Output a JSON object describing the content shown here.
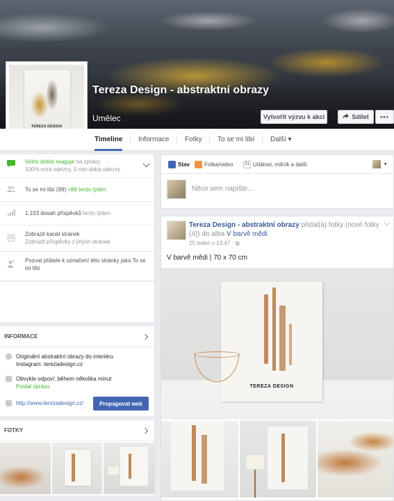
{
  "header": {
    "page_name": "Tereza Design - abstraktní obrazy",
    "category": "Umělec",
    "avatar_caption": "TEREZA DESIGN",
    "cta_label": "Vytvořit výzvu k akci",
    "share_label": "Sdílet",
    "more_label": "•••"
  },
  "tabs": [
    {
      "label": "Timeline",
      "active": true
    },
    {
      "label": "Informace"
    },
    {
      "label": "Fotky"
    },
    {
      "label": "To se mi líbí"
    },
    {
      "label": "Další ▾"
    }
  ],
  "left": {
    "responsiveness": {
      "title": "Velmi dobře reaguje",
      "title_suffix": " na zprávy",
      "detail": "100% míra odezvy, 5 min doba odezvy"
    },
    "likes": {
      "text": "To se mi líbí (99)",
      "growth": "+88 tento týden"
    },
    "reach": {
      "text": "1.103 dosah příspěvků",
      "suffix": " tento týden"
    },
    "channel": {
      "title": "Zobrazit kanál stránek",
      "subtitle": "Zobrazit příspěvky z jiných stránek"
    },
    "invite": {
      "text": "Pozvat přátele k označení této stránky jako To se mi líbí"
    },
    "info_header": "INFORMACE",
    "info": {
      "about": "Originální abstraktní obrazy do interiéru Instagram: terezadesign.cz",
      "reply": "Obvykle odpoví: během několika minut",
      "message_link": "Poslat zprávu",
      "website": "http://www.terezadesign.cz/",
      "promote_label": "Propagovat web"
    },
    "photos_header": "FOTKY"
  },
  "composer": {
    "tabs": [
      {
        "label": "Stav",
        "icon": "pencil-icon",
        "color": "#4267b2"
      },
      {
        "label": "Fotka/video",
        "icon": "photo-icon",
        "color": "#f7923b"
      },
      {
        "label": "Událost, milník a další",
        "icon": "calendar-icon",
        "color": "#e9ebee"
      }
    ],
    "placeholder": "Něco sem napište..."
  },
  "post": {
    "author": "Tereza Design - abstraktní obrazy",
    "action_1": " přidal(a) fotky (nové fotky (4)) do alba ",
    "album": "V barvě mědi",
    "action_2": ".",
    "time": "25 leden v 13:47 · ",
    "text": "V barvě mědi | 70 x 70 cm",
    "image_caption": "TEREZA DESIGN"
  },
  "colors": {
    "brand_blue": "#4267b2",
    "link_blue": "#365899",
    "green": "#42b72a",
    "copper": "#c08a5a"
  }
}
